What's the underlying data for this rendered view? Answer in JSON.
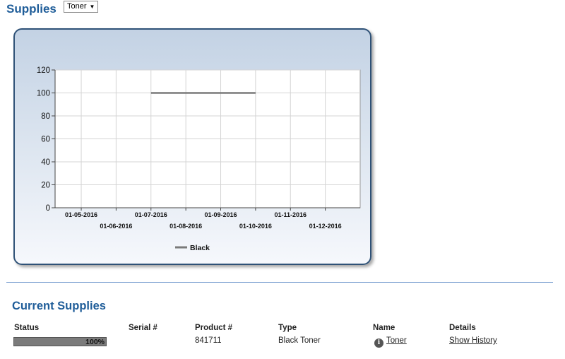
{
  "header": {
    "title": "Supplies",
    "filter_value": "Toner"
  },
  "chart_data": {
    "type": "line",
    "x": [
      "01-05-2016",
      "01-06-2016",
      "01-07-2016",
      "01-08-2016",
      "01-09-2016",
      "01-10-2016",
      "01-11-2016",
      "01-12-2016"
    ],
    "ylim": [
      0,
      120
    ],
    "yticks": [
      0,
      20,
      40,
      60,
      80,
      100,
      120
    ],
    "grid": true,
    "legend_placement": "bottom",
    "series": [
      {
        "name": "Black",
        "color": "#7a7a7a",
        "points": [
          [
            "01-07-2016",
            100
          ],
          [
            "01-10-2016",
            100
          ]
        ]
      }
    ]
  },
  "current": {
    "title": "Current Supplies",
    "columns": {
      "status": "Status",
      "serial": "Serial #",
      "product": "Product #",
      "type": "Type",
      "name": "Name",
      "details": "Details"
    },
    "row": {
      "status_percent": 100,
      "status_text": "100%",
      "serial": "",
      "product": "841711",
      "type": "Black Toner",
      "name": "Toner",
      "details": "Show History",
      "info_icon": "info-icon"
    }
  }
}
